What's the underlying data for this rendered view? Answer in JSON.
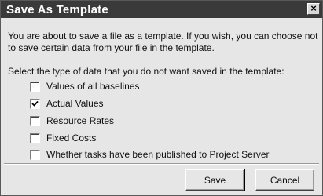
{
  "dialog": {
    "title": "Save As Template",
    "close_label": "×",
    "intro": "You are about to save a file as a template.  If you wish, you can choose not to save certain data from your file in the template.",
    "prompt": "Select the type of data that you do not want saved in the template:",
    "options": [
      {
        "label": "Values of all baselines",
        "checked": false
      },
      {
        "label": "Actual Values",
        "checked": true
      },
      {
        "label": "Resource Rates",
        "checked": false
      },
      {
        "label": "Fixed Costs",
        "checked": false
      },
      {
        "label": "Whether tasks have been published to Project Server",
        "checked": false
      }
    ],
    "buttons": {
      "save": "Save",
      "cancel": "Cancel"
    }
  },
  "colors": {
    "titlebar": "#3a3a3a",
    "face": "#e6e6e6"
  },
  "icons": {
    "check": "check-icon",
    "close": "close-icon"
  }
}
